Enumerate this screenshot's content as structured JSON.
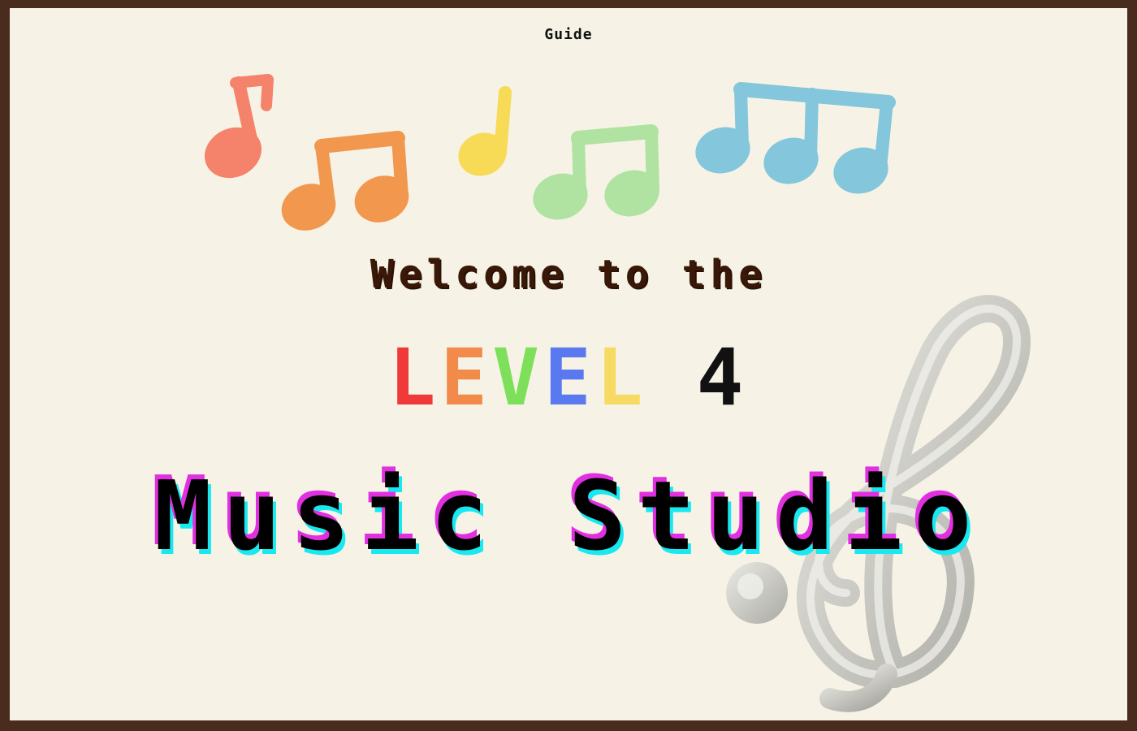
{
  "nav": {
    "guide_label": "Guide"
  },
  "hero": {
    "welcome": "Welcome to the",
    "level_letters": [
      {
        "char": "L",
        "color": "#f03a3a"
      },
      {
        "char": "E",
        "color": "#f28a4a"
      },
      {
        "char": "V",
        "color": "#7ee05a"
      },
      {
        "char": "E",
        "color": "#5a78f0"
      },
      {
        "char": "L",
        "color": "#f7da62"
      }
    ],
    "level_number": "4",
    "level_number_color": "#111111",
    "title": "Music Studio"
  },
  "decor": {
    "note_colors": [
      "#f5826a",
      "#f2984e",
      "#f7da55",
      "#b0e2a2",
      "#84c6db"
    ],
    "note_icons": [
      "eighth-note-icon",
      "beamed-eighth-notes-icon",
      "quarter-note-icon",
      "beamed-eighth-notes-icon",
      "beamed-triplet-notes-icon"
    ],
    "clef_icon": "treble-clef-icon"
  }
}
